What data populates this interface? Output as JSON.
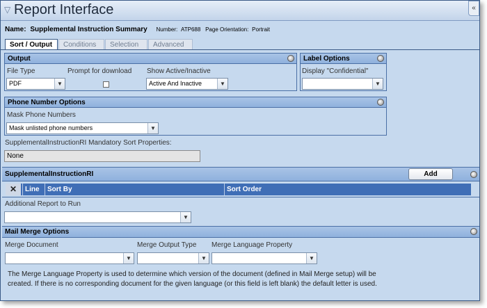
{
  "window": {
    "title": "Report Interface",
    "collapse_glyph": "«",
    "title_icon": "filter-icon"
  },
  "report": {
    "name_label": "Name:",
    "name_value": "Supplemental Instruction Summary",
    "number_label": "Number:",
    "number_value": "ATP688",
    "orientation_label": "Page Orientation:",
    "orientation_value": "Portrait"
  },
  "tabs": [
    {
      "label": "Sort / Output",
      "active": true
    },
    {
      "label": "Conditions",
      "active": false
    },
    {
      "label": "Selection",
      "active": false
    },
    {
      "label": "Advanced",
      "active": false
    }
  ],
  "output": {
    "header": "Output",
    "file_type_label": "File Type",
    "file_type_value": "PDF",
    "prompt_label": "Prompt for download",
    "prompt_checked": false,
    "show_active_label": "Show Active/Inactive",
    "show_active_value": "Active And Inactive"
  },
  "label_options": {
    "header": "Label Options",
    "display_confidential_label": "Display \"Confidential\"",
    "display_confidential_value": ""
  },
  "phone_options": {
    "header": "Phone Number Options",
    "mask_label": "Mask Phone Numbers",
    "mask_value": "Mask unlisted phone numbers"
  },
  "mandatory_sort": {
    "label": "SupplementalInstructionRI Mandatory Sort Properties:",
    "value": "None"
  },
  "sort_grid": {
    "header": "SupplementalInstructionRI",
    "add_label": "Add",
    "columns": [
      "Line",
      "Sort By",
      "Sort Order"
    ]
  },
  "additional_report": {
    "label": "Additional Report to Run",
    "value": ""
  },
  "mail_merge": {
    "header": "Mail Merge Options",
    "merge_document_label": "Merge Document",
    "merge_document_value": "",
    "merge_output_type_label": "Merge Output Type",
    "merge_output_type_value": "",
    "merge_language_label": "Merge Language Property",
    "merge_language_value": "",
    "note_line1": "The Merge Language Property is used to determine which version of the document (defined in Mail Merge setup) will be",
    "note_line2": "created. If there is no corresponding document for the given language (or this field is left blank) the default letter is used."
  },
  "colors": {
    "panel_bg": "#c6d9ee",
    "header_bg": "#8fb1dd",
    "grid_header": "#3f6eb6",
    "border": "#4a6fa5"
  }
}
